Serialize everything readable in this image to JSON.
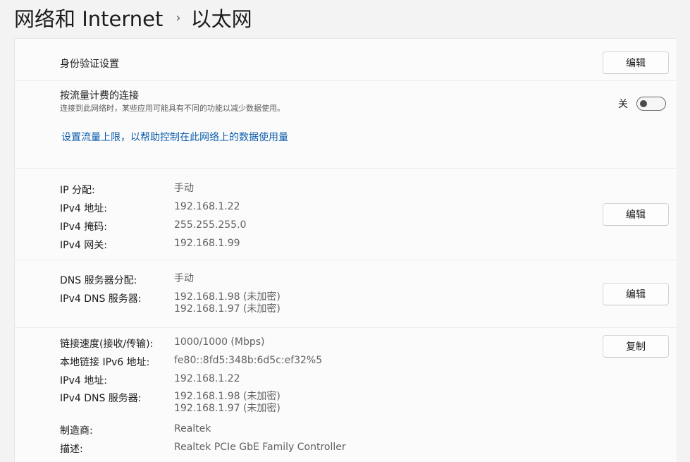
{
  "breadcrumb": {
    "parent": "网络和 Internet",
    "separator": "›",
    "current": "以太网"
  },
  "auth": {
    "title": "身份验证设置",
    "button": "编辑"
  },
  "metered": {
    "title": "按流量计费的连接",
    "description": "连接到此网络时，某些应用可能具有不同的功能以减少数据使用。",
    "toggle_state": "关",
    "toggle_on": false,
    "link": "设置流量上限，以帮助控制在此网络上的数据使用量"
  },
  "ip": {
    "button": "编辑",
    "rows": [
      {
        "key": "IP 分配:",
        "value": "手动"
      },
      {
        "key": "IPv4 地址:",
        "value": "192.168.1.22"
      },
      {
        "key": "IPv4 掩码:",
        "value": "255.255.255.0"
      },
      {
        "key": "IPv4 网关:",
        "value": "192.168.1.99"
      }
    ]
  },
  "dns": {
    "button": "编辑",
    "assign_key": "DNS 服务器分配:",
    "assign_value": "手动",
    "servers_key": "IPv4 DNS 服务器:",
    "servers": [
      "192.168.1.98 (未加密)",
      "192.168.1.97 (未加密)"
    ]
  },
  "props": {
    "button": "复制",
    "speed_key": "链接速度(接收/传输):",
    "speed_value": "1000/1000 (Mbps)",
    "ipv6_key": "本地链接 IPv6 地址:",
    "ipv6_value": "fe80::8fd5:348b:6d5c:ef32%5",
    "ipv4_key": "IPv4 地址:",
    "ipv4_value": "192.168.1.22",
    "dns_key": "IPv4 DNS 服务器:",
    "dns_values": [
      "192.168.1.98 (未加密)",
      "192.168.1.97 (未加密)"
    ],
    "maker_key": "制造商:",
    "maker_value": "Realtek",
    "desc_key": "描述:",
    "desc_value": "Realtek PCIe GbE Family Controller"
  }
}
